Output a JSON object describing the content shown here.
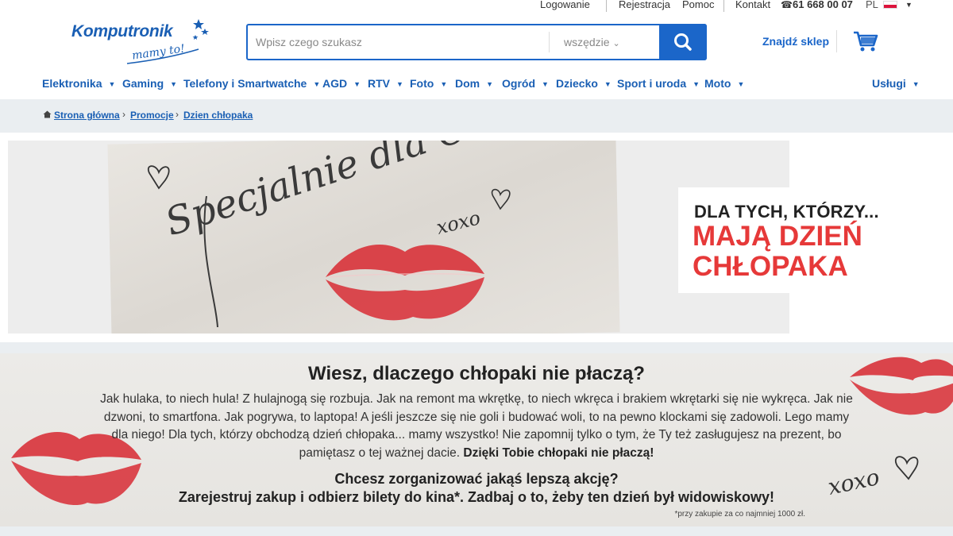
{
  "topbar": {
    "login": "Logowanie",
    "register": "Rejestracja",
    "help": "Pomoc",
    "contact": "Kontakt",
    "phone": "61 668 00 07",
    "language": "PL"
  },
  "header": {
    "logo_brand": "Komputronik",
    "logo_tagline": "mamy to!",
    "search_placeholder": "Wpisz czego szukasz",
    "search_scope": "wszędzie",
    "find_store": "Znajdź sklep"
  },
  "nav": {
    "items": [
      "Elektronika",
      "Gaming",
      "Telefony i Smartwatche",
      "AGD",
      "RTV",
      "Foto",
      "Dom",
      "Ogród",
      "Dziecko",
      "Sport i uroda",
      "Moto"
    ],
    "services": "Usługi"
  },
  "breadcrumb": [
    "Strona główna",
    "Promocje",
    "Dzien chłopaka"
  ],
  "hero": {
    "handwriting": "Specjalnie dla Ciebie",
    "xoxo": "xoxo",
    "line1": "DLA TYCH, KTÓRZY...",
    "line2": "MAJĄ DZIEŃ",
    "line3": "CHŁOPAKA"
  },
  "promo": {
    "heading": "Wiesz, dlaczego chłopaki nie płaczą?",
    "body": "Jak hulaka, to niech hula! Z hulajnogą się rozbuja. Jak na remont ma wkrętkę, to niech wkręca i brakiem wkrętarki się nie wykręca. Jak nie dzwoni, to smartfona. Jak pogrywa, to laptopa! A jeśli jeszcze się nie goli i budować woli, to na pewno klockami się zadowoli. Lego mamy dla niego! Dla tych, którzy obchodzą dzień chłopaka... mamy wszystko! Nie zapomnij tylko o tym, że Ty też zasługujesz na prezent, bo pamiętasz o tej ważnej dacie.",
    "body_bold": "Dzięki Tobie chłopaki nie płaczą!",
    "cta1": "Chcesz zorganizować jakąś lepszą akcję?",
    "cta2": "Zarejestruj zakup i odbierz bilety do kina*. Zadbaj o to, żeby ten dzień był widowiskowy!",
    "note": "*przy zakupie za co najmniej 1000 zł.",
    "xoxo": "xoxo"
  },
  "colors": {
    "brand_blue": "#1a5fb4",
    "search_blue": "#1b66c9",
    "accent_red": "#e63939",
    "lipstick": "#d8323a"
  }
}
